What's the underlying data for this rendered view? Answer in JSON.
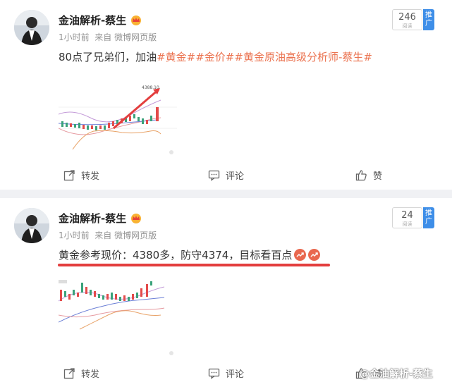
{
  "posts": [
    {
      "author": "金油解析-蔡生",
      "time": "1小时前",
      "source_prefix": "来自",
      "source": "微博网页版",
      "read_count": "246",
      "read_label": "阅读",
      "push_label": "推广",
      "text_plain": "80点了兄弟们，加油",
      "tags": [
        "#黄金#",
        "#金价#",
        "#黄金原油高级分析师-蔡生#"
      ],
      "chart_label": "4388.10",
      "repost": "转发",
      "comment": "评论",
      "like": "赞"
    },
    {
      "author": "金油解析-蔡生",
      "time": "1小时前",
      "source_prefix": "来自",
      "source": "微博网页版",
      "read_count": "24",
      "read_label": "阅读",
      "push_label": "推广",
      "text_plain": "黄金参考现价：4380多，防守4374，目标看百点",
      "repost": "转发",
      "comment": "评论",
      "like": "赞"
    }
  ],
  "watermark": "@金油解析-蔡生",
  "colors": {
    "tag": "#eb7350",
    "underline": "#e33e3e",
    "push_bg": "#3e8ee8",
    "trend_icon": "#e9684f"
  }
}
